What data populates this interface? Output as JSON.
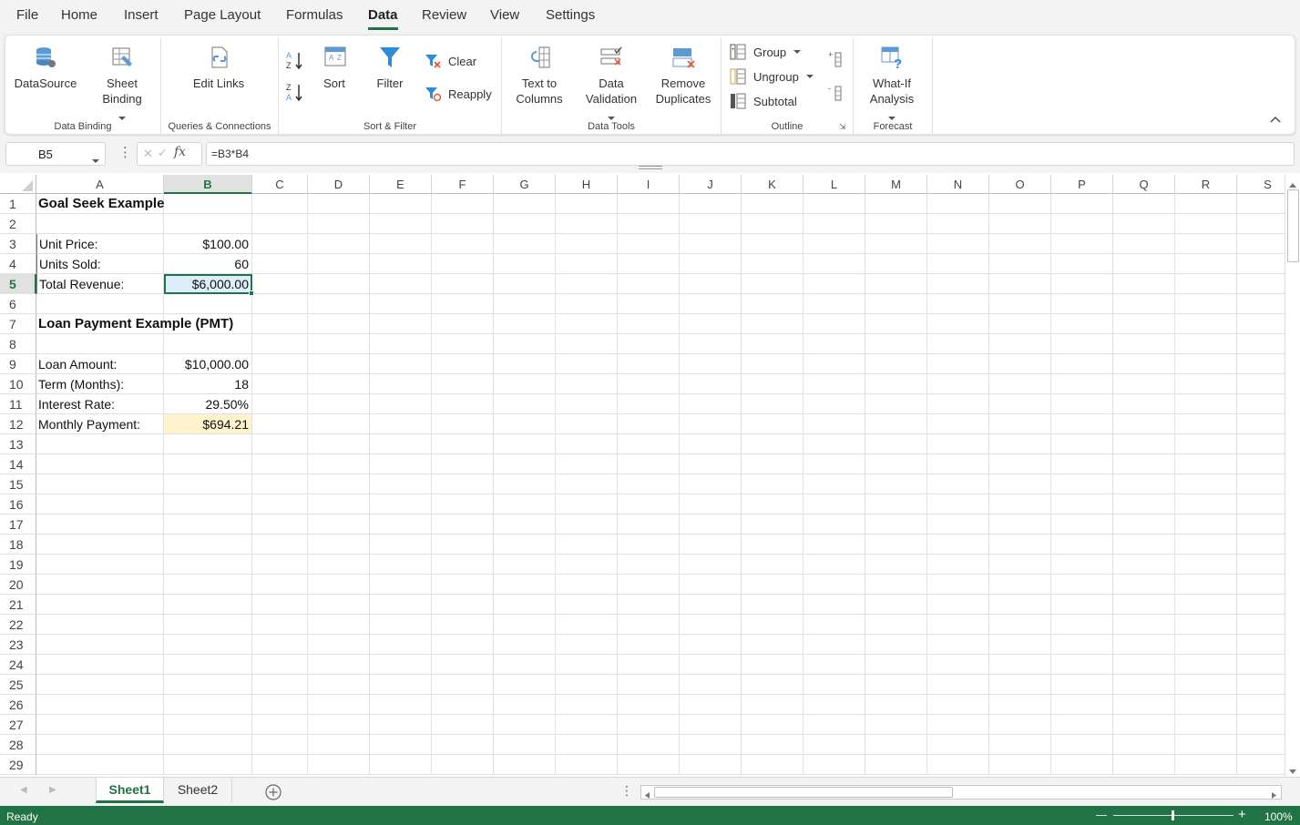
{
  "menu": {
    "items": [
      "File",
      "Home",
      "Insert",
      "Page Layout",
      "Formulas",
      "Data",
      "Review",
      "View",
      "Settings"
    ],
    "active": "Data"
  },
  "ribbon": {
    "datasource": "DataSource",
    "sheet_binding": "Sheet\nBinding",
    "edit_links": "Edit Links",
    "sort": "Sort",
    "filter": "Filter",
    "clear": "Clear",
    "reapply": "Reapply",
    "text_to_columns": "Text to\nColumns",
    "data_validation": "Data\nValidation",
    "remove_duplicates": "Remove\nDuplicates",
    "group": "Group",
    "ungroup": "Ungroup",
    "subtotal": "Subtotal",
    "what_if": "What-If\nAnalysis",
    "groups": {
      "data_binding": "Data Binding",
      "queries": "Queries & Connections",
      "sort_filter": "Sort & Filter",
      "data_tools": "Data Tools",
      "outline": "Outline",
      "forecast": "Forecast"
    }
  },
  "formula_bar": {
    "name_box": "B5",
    "fx": "fx",
    "formula": "=B3*B4"
  },
  "grid": {
    "columns": [
      "A",
      "B",
      "C",
      "D",
      "E",
      "F",
      "G",
      "H",
      "I",
      "J",
      "K",
      "L",
      "M",
      "N",
      "O",
      "P",
      "Q",
      "R",
      "S"
    ],
    "selected_column": "B",
    "selected_row": 5,
    "row_count": 29,
    "cells": {
      "A1": "Goal Seek Example",
      "A3": "Unit Price:",
      "B3": "$100.00",
      "A4": "Units Sold:",
      "B4": "60",
      "A5": "Total Revenue:",
      "B5": "$6,000.00",
      "A7": "Loan Payment Example (PMT)",
      "A9": "Loan Amount:",
      "B9": "$10,000.00",
      "A10": "Term (Months):",
      "B10": "18",
      "A11": "Interest Rate:",
      "B11": "29.50%",
      "A12": "Monthly Payment:",
      "B12": "$694.21"
    },
    "highlight_color": "#fff2cc",
    "selection_color": "#ddedfa",
    "accent": "#217346"
  },
  "sheets": {
    "tabs": [
      "Sheet1",
      "Sheet2"
    ],
    "active": "Sheet1"
  },
  "status": {
    "text": "Ready",
    "zoom": "100%"
  }
}
